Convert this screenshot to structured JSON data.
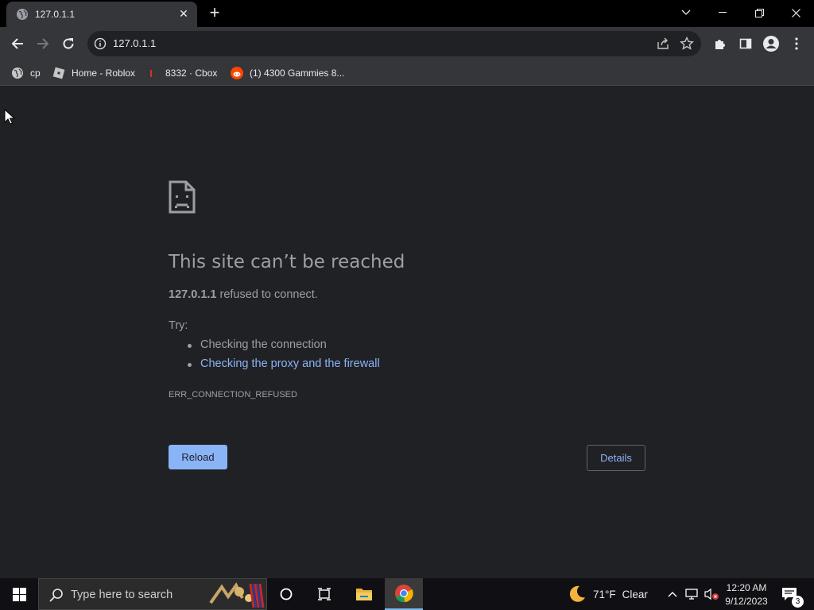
{
  "browser": {
    "tab": {
      "title": "127.0.1.1",
      "favicon": "globe-icon"
    },
    "address_bar": {
      "url": "127.0.1.1"
    },
    "bookmarks": [
      {
        "label": "cp",
        "icon": "globe-icon"
      },
      {
        "label": "Home - Roblox",
        "icon": "roblox-icon"
      },
      {
        "label": "8332 · Cbox",
        "icon": "cbox-icon"
      },
      {
        "label": "(1) 4300 Gammies 8...",
        "icon": "reddit-icon"
      }
    ]
  },
  "error_page": {
    "title": "This site can’t be reached",
    "host": "127.0.1.1",
    "message": " refused to connect.",
    "try_label": "Try:",
    "suggestions": [
      {
        "text": "Checking the connection",
        "link": false
      },
      {
        "text": "Checking the proxy and the firewall",
        "link": true
      }
    ],
    "error_code": "ERR_CONNECTION_REFUSED",
    "reload_label": "Reload",
    "details_label": "Details"
  },
  "taskbar": {
    "search_placeholder": "Type here to search",
    "weather": {
      "temp": "71°F",
      "condition": "Clear"
    },
    "clock": {
      "time": "12:20 AM",
      "date": "9/12/2023"
    },
    "notification_count": "3"
  },
  "colors": {
    "page_bg": "#202124",
    "toolbar_bg": "#35363a",
    "link": "#8ab4f8",
    "text_muted": "#9aa0a6",
    "taskbar_bg": "#101014"
  }
}
